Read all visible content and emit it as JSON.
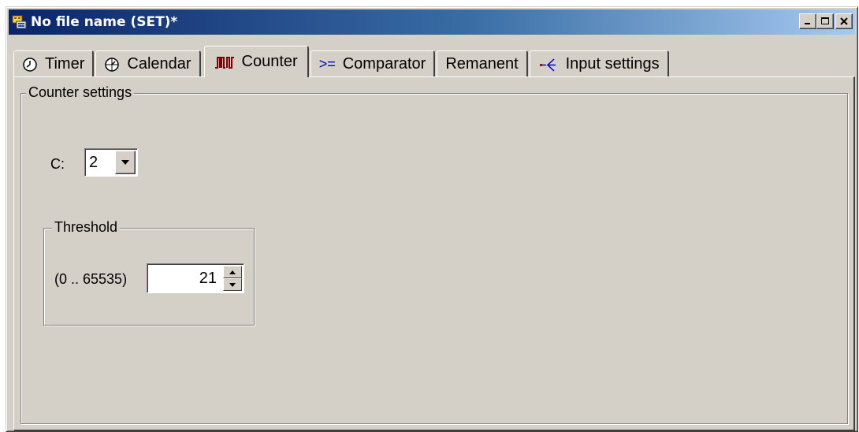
{
  "window": {
    "title": "No file name (SET)*",
    "buttons": {
      "minimize": "minimize-icon",
      "maximize": "maximize-icon",
      "close": "close-icon"
    }
  },
  "tabs": [
    {
      "label": "Timer",
      "icon": "clock-icon",
      "active": false
    },
    {
      "label": "Calendar",
      "icon": "calendar-clock-icon",
      "active": false
    },
    {
      "label": "Counter",
      "icon": "counter-pulse-icon",
      "active": true
    },
    {
      "label": "Comparator",
      "icon": ">=",
      "active": false
    },
    {
      "label": "Remanent",
      "icon": "",
      "active": false
    },
    {
      "label": "Input settings",
      "icon": "input-settings-icon",
      "active": false
    }
  ],
  "counter_settings": {
    "group_label": "Counter settings",
    "counter_label": "C:",
    "counter_value": "2",
    "threshold": {
      "group_label": "Threshold",
      "range_label": "(0 .. 65535)",
      "value": "21"
    }
  },
  "colors": {
    "face": "#d4d0c8",
    "title_start": "#0a246a",
    "title_end": "#a6caf0",
    "counter_icon": "#800000",
    "comparator_icon": "#0000c0"
  }
}
